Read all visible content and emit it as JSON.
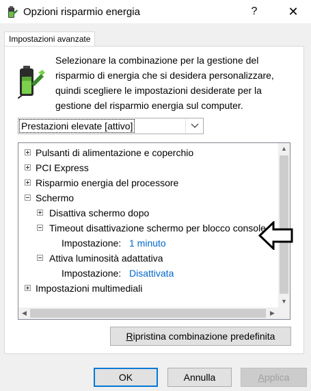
{
  "window": {
    "title": "Opzioni risparmio energia",
    "help_glyph": "?",
    "close_glyph": "✕"
  },
  "tab": {
    "label": "Impostazioni avanzate"
  },
  "description": "Selezionare la combinazione per la gestione del risparmio di energia che si desidera personalizzare, quindi scegliere le impostazioni desiderate per la gestione del risparmio energia sul computer.",
  "plan_select": {
    "value": "Prestazioni elevate [attivo]"
  },
  "tree": {
    "items": [
      {
        "label": "Pulsanti di alimentazione e coperchio",
        "state": "collapsed"
      },
      {
        "label": "PCI Express",
        "state": "collapsed"
      },
      {
        "label": "Risparmio energia del processore",
        "state": "collapsed"
      },
      {
        "label": "Schermo",
        "state": "expanded"
      },
      {
        "label": "Disattiva schermo dopo",
        "state": "collapsed"
      },
      {
        "label": "Timeout disattivazione schermo per blocco console",
        "state": "expanded"
      },
      {
        "label": "Impostazione:",
        "value": "1 minuto"
      },
      {
        "label": "Attiva luminosità adattativa",
        "state": "expanded"
      },
      {
        "label": "Impostazione:",
        "value": "Disattivata"
      },
      {
        "label": "Impostazioni multimediali",
        "state": "collapsed"
      }
    ]
  },
  "buttons": {
    "restore_first": "R",
    "restore_rest": "ipristina combinazione predefinita",
    "ok": "OK",
    "cancel": "Annulla",
    "apply_first": "A",
    "apply_rest": "pplica"
  },
  "colors": {
    "link": "#0066cc",
    "default_button_border": "#0078d7"
  }
}
